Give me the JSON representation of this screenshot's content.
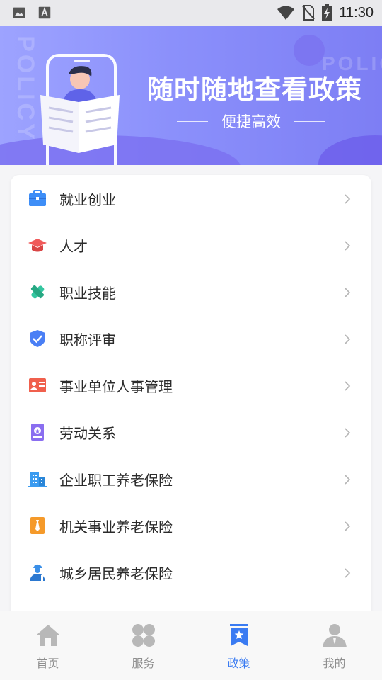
{
  "status_bar": {
    "time": "11:30",
    "left_icons": [
      "image-icon",
      "font-a-icon"
    ],
    "right_icons": [
      "wifi-icon",
      "no-sim-icon",
      "battery-charging-icon"
    ]
  },
  "banner": {
    "title": "随时随地查看政策",
    "subtitle": "便捷高效",
    "bg_text_left": "POLICY",
    "bg_text_right": "POLIC",
    "colors": {
      "start": "#9da3ff",
      "end": "#7d7ef4"
    }
  },
  "menu": {
    "items": [
      {
        "label": "就业创业",
        "icon": "briefcase-icon",
        "color": "#3e8ef7"
      },
      {
        "label": "人才",
        "icon": "graduation-cap-icon",
        "color": "#f05a5a"
      },
      {
        "label": "职业技能",
        "icon": "tools-icon",
        "color": "#34c6a0"
      },
      {
        "label": "职称评审",
        "icon": "shield-check-icon",
        "color": "#4a7ff5"
      },
      {
        "label": "事业单位人事管理",
        "icon": "id-card-icon",
        "color": "#f0604d"
      },
      {
        "label": "劳动关系",
        "icon": "handbook-icon",
        "color": "#8a6ef0"
      },
      {
        "label": "企业职工养老保险",
        "icon": "building-icon",
        "color": "#3a9bf0"
      },
      {
        "label": "机关事业养老保险",
        "icon": "tie-icon",
        "color": "#f59a2a"
      },
      {
        "label": "城乡居民养老保险",
        "icon": "worker-icon",
        "color": "#3a8fe8"
      }
    ]
  },
  "tabbar": {
    "active_color": "#3a7bf2",
    "tabs": [
      {
        "label": "首页",
        "icon": "home-icon"
      },
      {
        "label": "服务",
        "icon": "grid-icon"
      },
      {
        "label": "政策",
        "icon": "policy-bookmark-icon",
        "active": true
      },
      {
        "label": "我的",
        "icon": "user-icon"
      }
    ]
  }
}
